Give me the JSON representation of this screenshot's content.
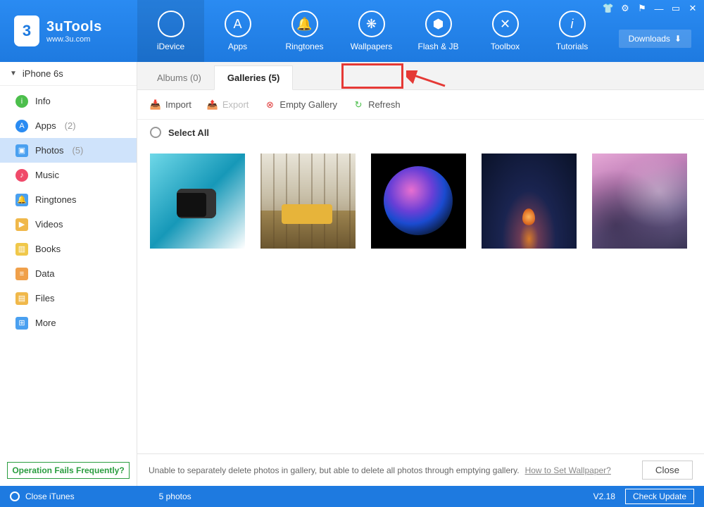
{
  "app": {
    "name": "3uTools",
    "site": "www.3u.com"
  },
  "nav": [
    {
      "label": "iDevice"
    },
    {
      "label": "Apps"
    },
    {
      "label": "Ringtones"
    },
    {
      "label": "Wallpapers"
    },
    {
      "label": "Flash & JB"
    },
    {
      "label": "Toolbox"
    },
    {
      "label": "Tutorials"
    }
  ],
  "downloads_label": "Downloads",
  "device_name": "iPhone 6s",
  "sidebar": [
    {
      "label": "Info",
      "count": ""
    },
    {
      "label": "Apps",
      "count": "(2)"
    },
    {
      "label": "Photos",
      "count": "(5)"
    },
    {
      "label": "Music",
      "count": ""
    },
    {
      "label": "Ringtones",
      "count": ""
    },
    {
      "label": "Videos",
      "count": ""
    },
    {
      "label": "Books",
      "count": ""
    },
    {
      "label": "Data",
      "count": ""
    },
    {
      "label": "Files",
      "count": ""
    },
    {
      "label": "More",
      "count": ""
    }
  ],
  "op_fail": "Operation Fails Frequently?",
  "tabs": [
    {
      "label": "Albums (0)"
    },
    {
      "label": "Galleries (5)"
    }
  ],
  "toolbar": {
    "import": "Import",
    "export": "Export",
    "empty": "Empty Gallery",
    "refresh": "Refresh"
  },
  "select_all": "Select All",
  "info_bar": {
    "text": "Unable to separately delete photos in gallery, but able to delete all photos through emptying gallery.",
    "link": "How to Set Wallpaper?",
    "close": "Close"
  },
  "footer": {
    "close_itunes": "Close iTunes",
    "status": "5 photos",
    "version": "V2.18",
    "check_update": "Check Update"
  }
}
